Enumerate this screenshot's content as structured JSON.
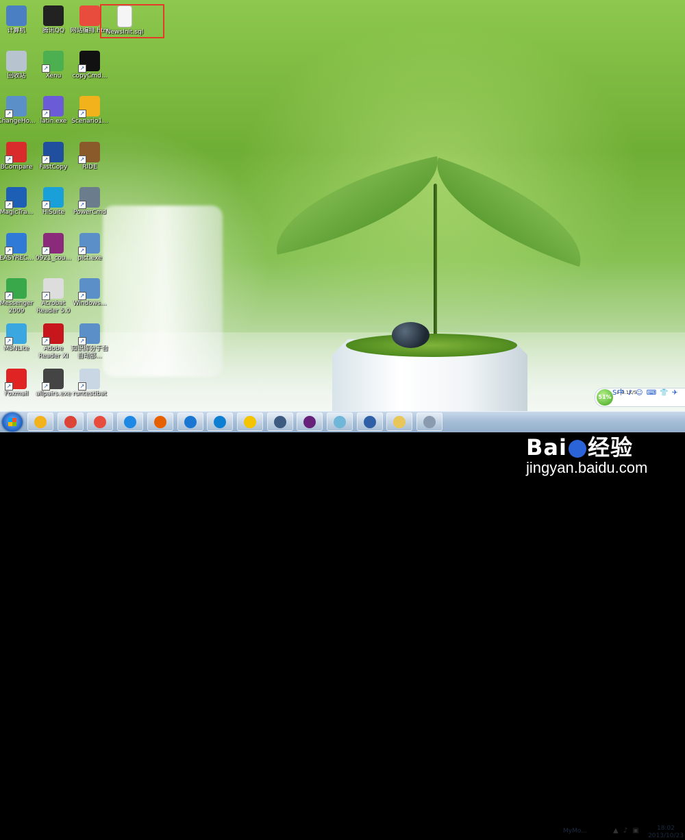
{
  "desktop": {
    "icons": [
      {
        "label": "计算机",
        "icon": "computer-icon",
        "color": "#4a7fc4"
      },
      {
        "label": "腾讯QQ",
        "icon": "qq-penguin-icon",
        "color": "#222222"
      },
      {
        "label": "网站编排.htm",
        "icon": "browser-colorful-icon",
        "color": "#e74c3c"
      },
      {
        "label": "NewsInit.sql",
        "icon": "document-icon",
        "color": "#f5f5f5"
      },
      {
        "label": "回收站",
        "icon": "recycle-bin-icon",
        "color": "#b7c4cf"
      },
      {
        "label": "Xenu",
        "icon": "xenu-icon",
        "color": "#4caf50"
      },
      {
        "label": "copyCmd...",
        "icon": "console-icon",
        "color": "#111111"
      },
      {
        "label": "ChangeHo...",
        "icon": "window-icon",
        "color": "#5b8fc7"
      },
      {
        "label": "latin.exe",
        "icon": "arrow-app-icon",
        "color": "#6b5bd6"
      },
      {
        "label": "Scenario1...",
        "icon": "scenario-icon",
        "color": "#f2b21c"
      },
      {
        "label": "BCompare",
        "icon": "bcompare-icon",
        "color": "#d92b2b"
      },
      {
        "label": "FastCopy",
        "icon": "fastcopy-icon",
        "color": "#1f4f9e"
      },
      {
        "label": "RIDE",
        "icon": "ride-robot-icon",
        "color": "#8a5a2b"
      },
      {
        "label": "MagicTra...",
        "icon": "magic-icon",
        "color": "#1c5fb4"
      },
      {
        "label": "HiSuite",
        "icon": "phone-icon",
        "color": "#19a0d8"
      },
      {
        "label": "PowerCmd",
        "icon": "powercmd-icon",
        "color": "#6b7d8c"
      },
      {
        "label": "EASYREC...",
        "icon": "chart-app-icon",
        "color": "#2f7ad6"
      },
      {
        "label": "0921_cou...",
        "icon": "archive-icon",
        "color": "#8b2a7a"
      },
      {
        "label": "pict.exe",
        "icon": "window-icon",
        "color": "#5b8fc7"
      },
      {
        "label": "Messenger 2009",
        "icon": "messenger-icon",
        "color": "#38a84b"
      },
      {
        "label": "Acrobat Reader 5.0",
        "icon": "calculator-icon",
        "color": "#dddddd"
      },
      {
        "label": "Windows...",
        "icon": "window-icon",
        "color": "#5b8fc7"
      },
      {
        "label": "MSNLite",
        "icon": "msn-icon",
        "color": "#3aa7e0"
      },
      {
        "label": "Adobe Reader XI",
        "icon": "adobe-reader-icon",
        "color": "#c8161d"
      },
      {
        "label": "知识库分于台自动部...",
        "icon": "window-icon",
        "color": "#5b8fc7"
      },
      {
        "label": "Foxmail",
        "icon": "foxmail-icon",
        "color": "#e02424"
      },
      {
        "label": "allpairs.exe",
        "icon": "gear-people-icon",
        "color": "#444444"
      },
      {
        "label": "runtestibat",
        "icon": "settings-file-icon",
        "color": "#c9d6e3"
      }
    ]
  },
  "widget": {
    "percent": "51%",
    "speed": "0.1K/S",
    "ime": "S中 ♪ ☺ ⌨ 👕 ✈"
  },
  "taskbar": {
    "buttons": [
      {
        "name": "windows-explorer-icon",
        "color": "#f2b21c"
      },
      {
        "name": "chrome-icon",
        "color": "#db4437"
      },
      {
        "name": "browser-colorful-icon",
        "color": "#e74c3c"
      },
      {
        "name": "ie-icon",
        "color": "#1e88e5"
      },
      {
        "name": "firefox-icon",
        "color": "#e66000"
      },
      {
        "name": "maxthon-icon",
        "color": "#1976d2"
      },
      {
        "name": "sogou-icon",
        "color": "#0d7fd3"
      },
      {
        "name": "ie-tester-icon",
        "color": "#f5c400"
      },
      {
        "name": "star-app-icon",
        "color": "#3d5a80"
      },
      {
        "name": "visual-studio-icon",
        "color": "#68217a"
      },
      {
        "name": "notepad-icon",
        "color": "#6fb7d8"
      },
      {
        "name": "remote-desktop-icon",
        "color": "#2f5fa7"
      },
      {
        "name": "folder-icon",
        "color": "#e9c65a"
      },
      {
        "name": "tools-icon",
        "color": "#8a9bb0"
      }
    ],
    "tray_name": "MyMo...",
    "time": "18:02",
    "date": "2013/10/23"
  },
  "watermark": {
    "brand_left": "Bai",
    "brand_right": "经验",
    "url": "jingyan.baidu.com"
  }
}
